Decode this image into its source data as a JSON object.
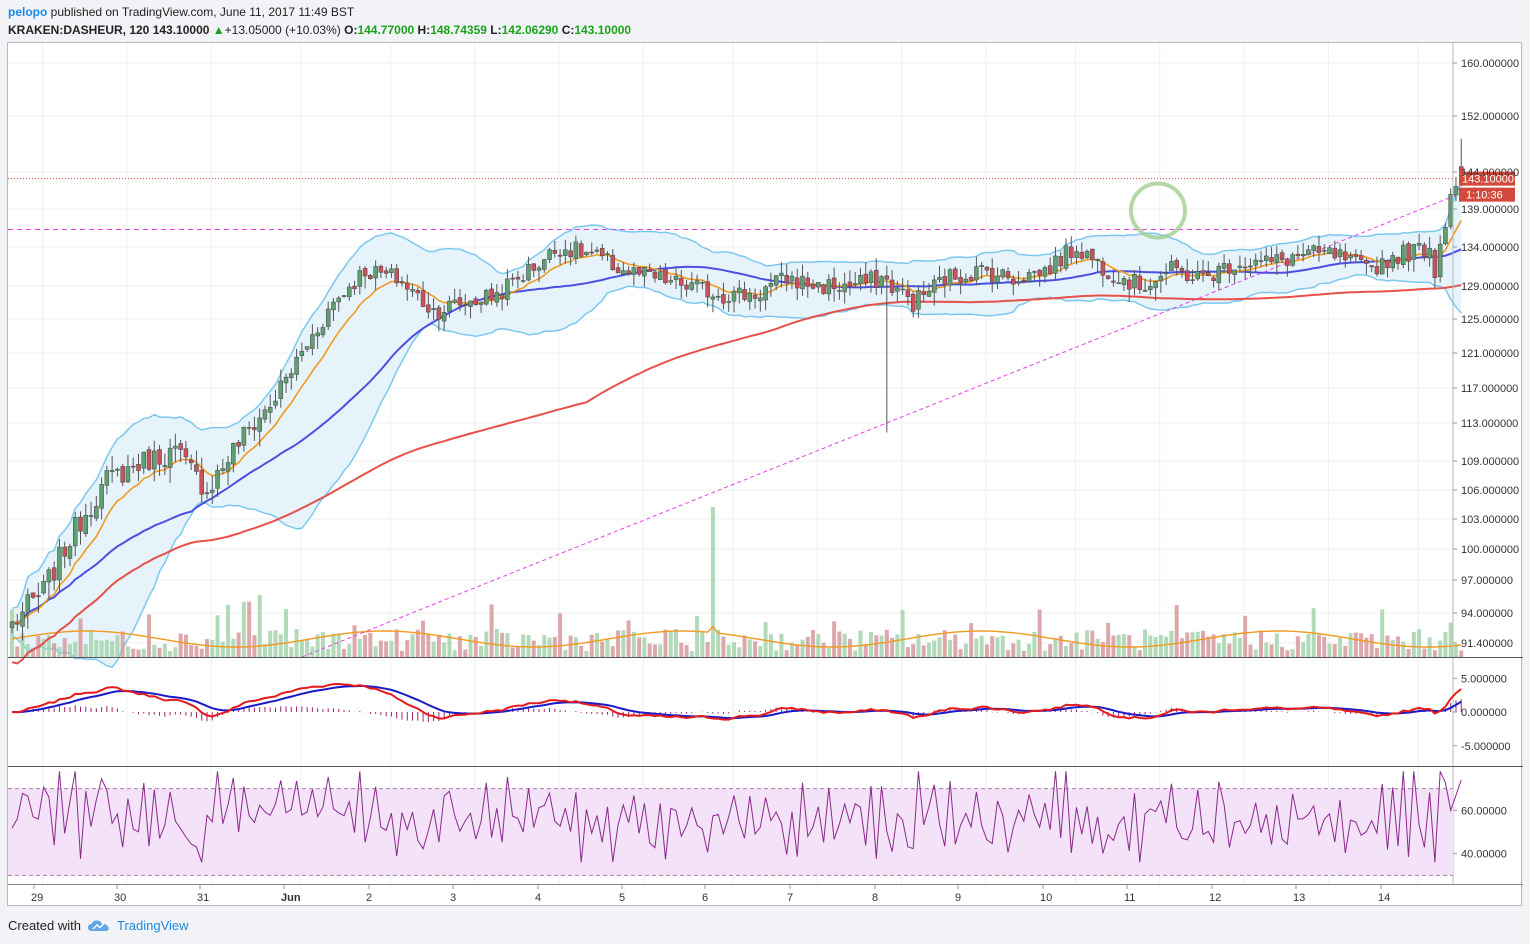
{
  "header": {
    "author": "pelopo",
    "published_text": "published on TradingView.com, June 11, 2017 11:49 BST"
  },
  "symbol": {
    "name": "KRAKEN:DASHEUR, 120",
    "last": "143.10000",
    "change_arrow": "▲",
    "change": "+13.05000 (+10.03%)",
    "o_label": "O:",
    "o_value": "144.77000",
    "h_label": "H:",
    "h_value": "148.74359",
    "l_label": "L:",
    "l_value": "142.06290",
    "c_label": "C:",
    "c_value": "143.10000"
  },
  "footer": {
    "created_with": "Created with",
    "brand": "TradingView",
    "logo_icon": "cloud-logo-icon"
  },
  "colors": {
    "up": "#5b9a6b",
    "down": "#c2484e",
    "up_fill": "#a4d3ad",
    "down_fill": "#d7999c",
    "ema_fast": "#f19a1f",
    "sma_mid": "#4b50e0",
    "sma_slow": "#e8504a",
    "bollinger": "#7cc8ee",
    "bollinger_fill": "#e6f3fb",
    "level_line": "#e63ee6",
    "macd_line": "#e51a1a",
    "macd_signal": "#1a1ac8",
    "macd_hist": "#a0226e",
    "rsi_line": "#8a2a8a",
    "rsi_band": "#f3e2f8",
    "price_label_bg": "#d24a3c"
  },
  "chart_data": {
    "type": "candlestick",
    "price_axis": {
      "ticks": [
        "160.000000",
        "152.000000",
        "144.000000",
        "139.000000",
        "134.000000",
        "129.000000",
        "125.000000",
        "121.000000",
        "117.000000",
        "113.000000",
        "109.000000",
        "106.000000",
        "103.000000",
        "100.000000",
        "97.000000",
        "94.000000",
        "91.400000"
      ],
      "ylim": [
        90,
        162
      ]
    },
    "time_axis": {
      "labels": [
        "29",
        "30",
        "31",
        "Jun",
        "2",
        "3",
        "4",
        "5",
        "6",
        "7",
        "8",
        "9",
        "10",
        "11",
        "12",
        "13",
        "14"
      ]
    },
    "last_price_label": "143.10000",
    "countdown_label": "1:10:36",
    "close_anchors": [
      [
        0,
        93
      ],
      [
        6,
        96
      ],
      [
        12,
        102
      ],
      [
        18,
        107
      ],
      [
        25,
        109
      ],
      [
        31,
        110
      ],
      [
        37,
        106
      ],
      [
        43,
        111
      ],
      [
        49,
        115
      ],
      [
        55,
        121
      ],
      [
        61,
        127
      ],
      [
        67,
        131
      ],
      [
        73,
        130
      ],
      [
        80,
        126
      ],
      [
        86,
        127
      ],
      [
        92,
        128
      ],
      [
        98,
        131
      ],
      [
        104,
        134
      ],
      [
        110,
        133
      ],
      [
        116,
        131
      ],
      [
        122,
        130
      ],
      [
        128,
        129
      ],
      [
        135,
        128
      ],
      [
        141,
        128
      ],
      [
        147,
        130
      ],
      [
        153,
        129
      ],
      [
        159,
        129
      ],
      [
        165,
        130
      ],
      [
        171,
        127
      ],
      [
        177,
        130
      ],
      [
        184,
        131
      ],
      [
        190,
        130
      ],
      [
        196,
        131
      ],
      [
        202,
        134
      ],
      [
        208,
        131
      ],
      [
        214,
        129
      ],
      [
        220,
        131
      ],
      [
        226,
        130
      ],
      [
        232,
        132
      ],
      [
        239,
        132
      ],
      [
        245,
        133
      ],
      [
        251,
        133
      ],
      [
        257,
        131
      ],
      [
        263,
        133
      ],
      [
        269,
        134
      ],
      [
        270,
        131
      ],
      [
        273,
        141
      ],
      [
        275,
        143.1
      ]
    ],
    "macd": {
      "axis_ticks": [
        "5.000000",
        "0.000000",
        "-5.000000"
      ],
      "ylim": [
        -8,
        8
      ]
    },
    "rsi": {
      "axis_ticks": [
        "60.00000",
        "40.00000"
      ],
      "band": [
        30,
        70
      ],
      "ylim": [
        26,
        80
      ]
    }
  }
}
